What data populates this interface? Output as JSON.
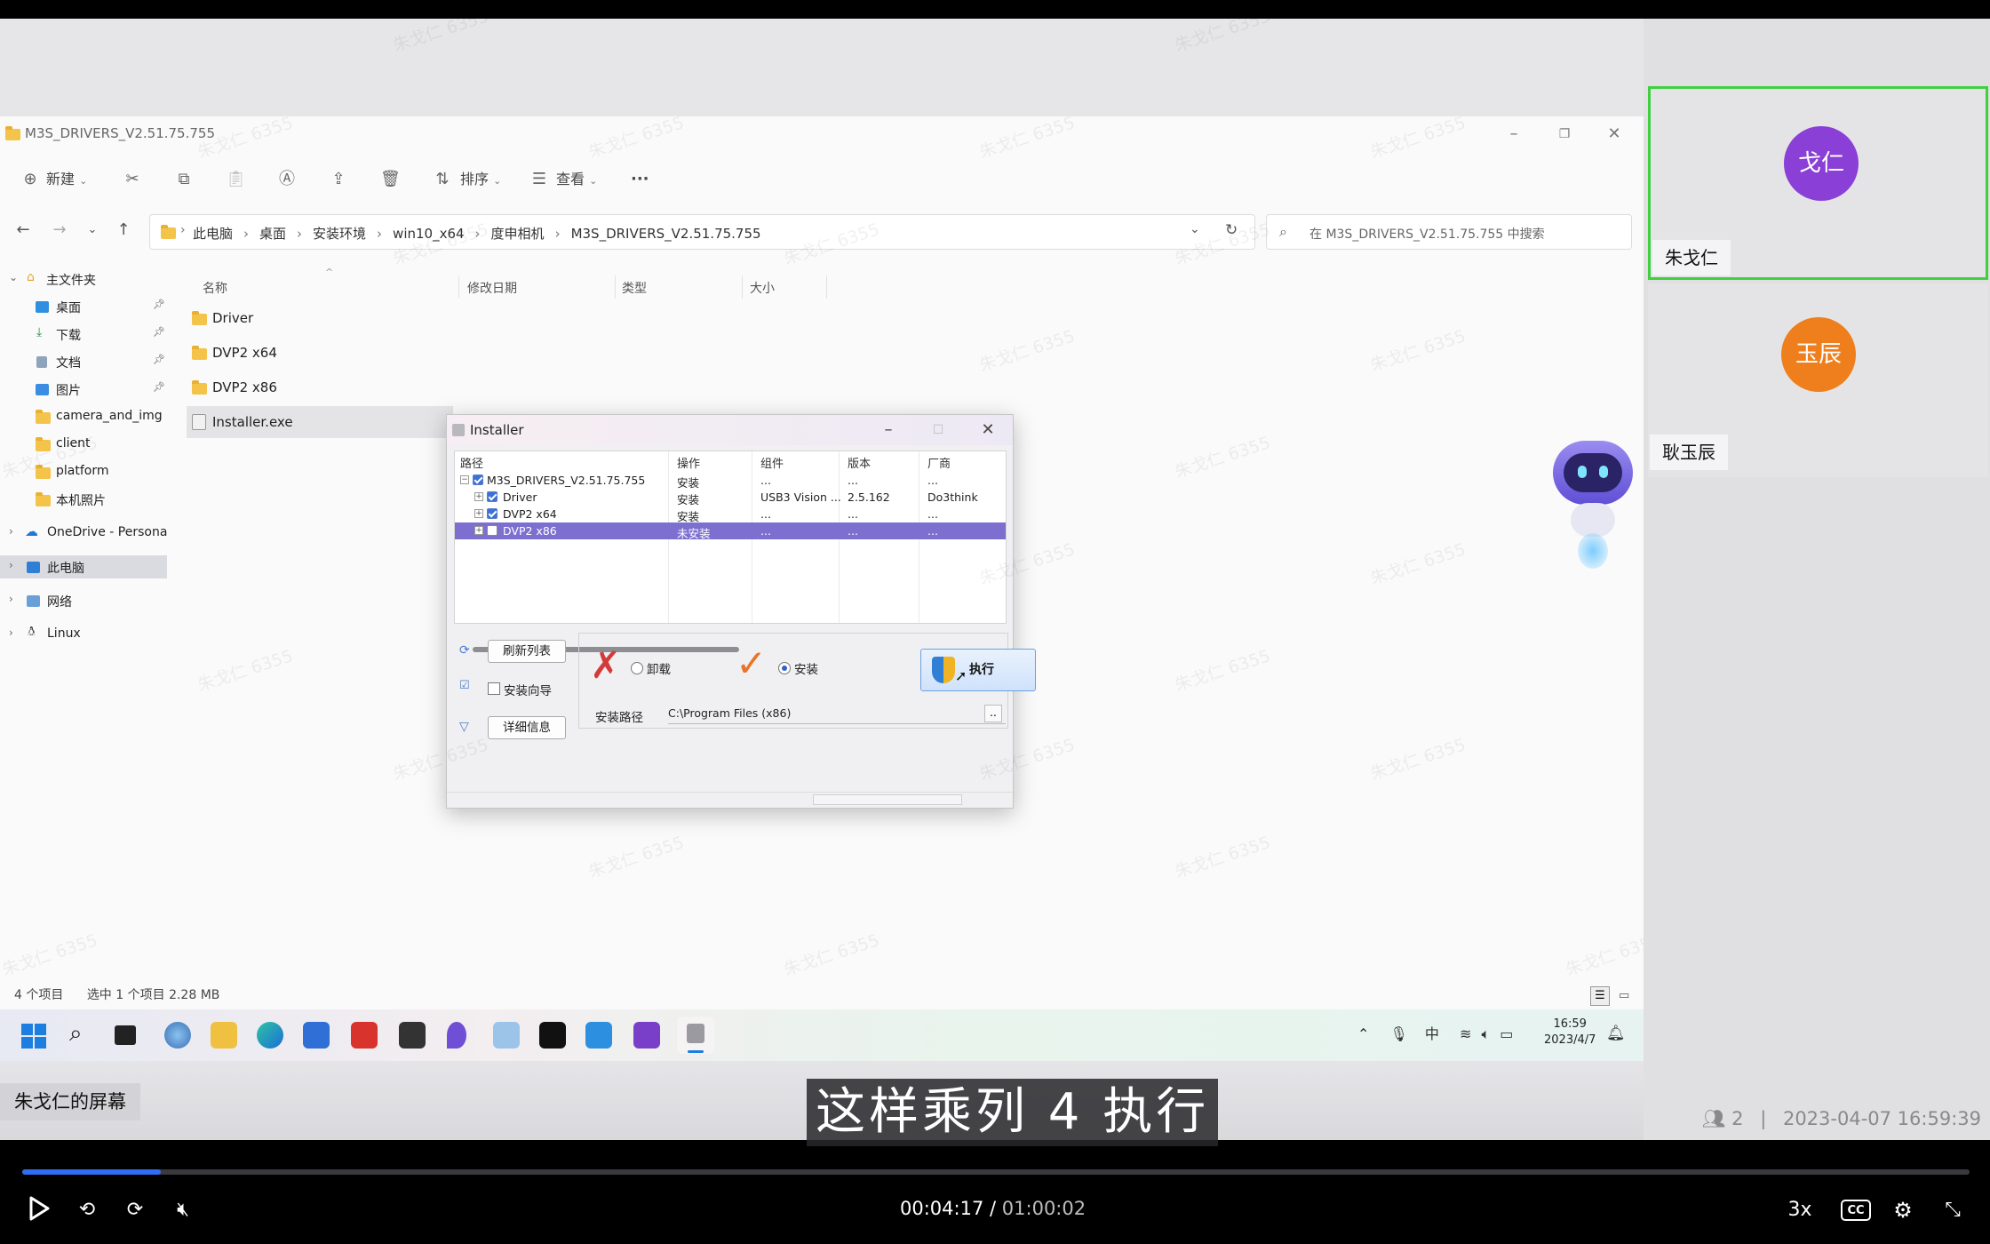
{
  "explorer": {
    "window_title": "M3S_DRIVERS_V2.51.75.755",
    "toolbar": {
      "new_label": "新建",
      "sort_label": "排序",
      "view_label": "查看",
      "more_label": "···"
    },
    "breadcrumbs": [
      "此电脑",
      "桌面",
      "安装环境",
      "win10_x64",
      "度申相机",
      "M3S_DRIVERS_V2.51.75.755"
    ],
    "search_placeholder": "在 M3S_DRIVERS_V2.51.75.755 中搜索",
    "nav": {
      "home": "主文件夹",
      "desktop": "桌面",
      "downloads": "下载",
      "documents": "文档",
      "pictures": "图片",
      "camera": "camera_and_img",
      "client": "client",
      "platform": "platform",
      "local_photos": "本机照片",
      "onedrive": "OneDrive - Persona",
      "this_pc": "此电脑",
      "network": "网络",
      "linux": "Linux"
    },
    "columns": {
      "name": "名称",
      "modified": "修改日期",
      "type": "类型",
      "size": "大小"
    },
    "files": [
      {
        "name": "Driver"
      },
      {
        "name": "DVP2 x64"
      },
      {
        "name": "DVP2 x86"
      },
      {
        "name": "Installer.exe"
      }
    ],
    "status": {
      "count": "4 个项目",
      "selection": "选中 1 个项目  2.28 MB"
    }
  },
  "installer": {
    "title": "Installer",
    "columns": {
      "path": "路径",
      "action": "操作",
      "component": "组件",
      "version": "版本",
      "vendor": "厂商"
    },
    "rows": [
      {
        "path": "M3S_DRIVERS_V2.51.75.755",
        "action": "安装",
        "component": "...",
        "version": "...",
        "vendor": "..."
      },
      {
        "path": "Driver",
        "action": "安装",
        "component": "USB3 Vision ...",
        "version": "2.5.162",
        "vendor": "Do3think"
      },
      {
        "path": "DVP2 x64",
        "action": "安装",
        "component": "...",
        "version": "...",
        "vendor": "..."
      },
      {
        "path": "DVP2 x86",
        "action": "未安装",
        "component": "...",
        "version": "...",
        "vendor": "..."
      }
    ],
    "refresh_label": "刷新列表",
    "wizard_label": "安装向导",
    "details_label": "详细信息",
    "uninstall_label": "卸载",
    "install_label": "安装",
    "execute_label": "执行",
    "install_path_label": "安装路径",
    "install_path_value": "C:\\Program Files (x86)",
    "browse_label": "..",
    "selected_mode": "install"
  },
  "taskbar": {
    "ime": "中",
    "time": "16:59",
    "date": "2023/4/7"
  },
  "meeting": {
    "screen_owner": "朱戈仁的屏幕",
    "participants": [
      {
        "avatar_text": "戈仁",
        "name": "朱戈仁",
        "color": "#8a3fd6",
        "active": true
      },
      {
        "avatar_text": "玉辰",
        "name": "耿玉辰",
        "color": "#ee7f1c",
        "active": false
      }
    ],
    "participant_count": "2",
    "recorded_at": "2023-04-07 16:59:39",
    "watermark": "朱戈仁 6355"
  },
  "subtitle": "这样乘列 4 执行",
  "player": {
    "current_time": "00:04:17",
    "separator": "/",
    "duration": "01:00:02",
    "progress_fraction": 0.071,
    "speed": "3x",
    "cc_label": "CC"
  }
}
